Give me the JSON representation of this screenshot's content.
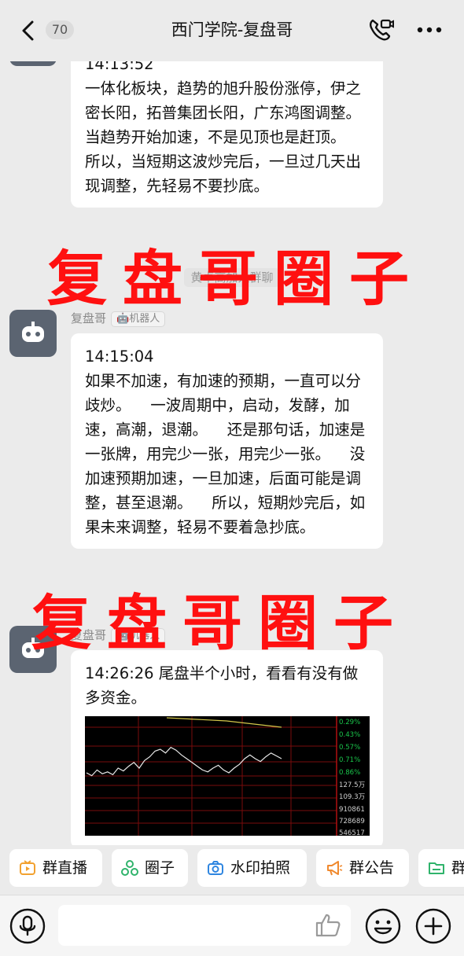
{
  "header": {
    "back_icon": "chevron-left-icon",
    "unread_count": "70",
    "title": "西门学院-复盘哥",
    "call_icon": "video-call-icon",
    "more_icon": "more-dots-icon"
  },
  "messages": [
    {
      "sender": "",
      "time": "14:13:52",
      "text": "一体化板块，趋势的旭升股份涨停，伊之密长阳，拓普集团长阳，广东鸿图调整。    当趋势开始加速，不是见顶也是赶顶。    所以，当短期这波炒完后，一旦过几天出现调整，先轻易不要抄底。"
    },
    {
      "sender": "复盘哥",
      "tag": "机器人",
      "time": "14:15:04",
      "text": "如果不加速，有加速的预期，一直可以分歧炒。    一波周期中，启动，发酵，加速，高潮，退潮。    还是那句话，加速是一张牌，用完少一张，用完少一张。    没加速预期加速，一旦加速，后面可能是调整，甚至退潮。    所以，短期炒完后，如果未来调整，轻易不要着急抄底。"
    },
    {
      "sender": "复盘哥",
      "tag": "机器人",
      "time": "14:26:26",
      "text": "尾盘半个小时，看看有没有做多资金。"
    }
  ],
  "system_notice": "黄卓高加入群聊",
  "watermarks": [
    "复盘哥圈子",
    "复盘哥圈子"
  ],
  "chart_data": {
    "type": "line",
    "title": "",
    "right_axis_labels": [
      "0.29%",
      "0.43%",
      "0.57%",
      "0.71%",
      "0.86%",
      "127.5万",
      "109.3万",
      "910861",
      "728689",
      "546517"
    ],
    "series": [
      {
        "values": [
          0.55,
          0.52,
          0.58,
          0.54,
          0.56,
          0.53,
          0.6,
          0.57,
          0.62,
          0.66,
          0.6,
          0.68,
          0.72,
          0.78,
          0.8,
          0.76,
          0.82,
          0.79,
          0.74,
          0.7,
          0.66,
          0.62,
          0.58,
          0.56,
          0.6,
          0.63,
          0.58,
          0.55,
          0.6,
          0.64,
          0.7,
          0.74,
          0.7,
          0.67,
          0.72,
          0.76,
          0.73,
          0.7
        ]
      }
    ]
  },
  "toolbar": {
    "items": [
      {
        "label": "群直播",
        "icon": "live-tv-icon",
        "color": "#f2a12f"
      },
      {
        "label": "圈子",
        "icon": "circle-group-icon",
        "color": "#2fb36b"
      },
      {
        "label": "水印拍照",
        "icon": "camera-icon",
        "color": "#2f86e0"
      },
      {
        "label": "群公告",
        "icon": "megaphone-icon",
        "color": "#f0892e"
      },
      {
        "label": "群",
        "icon": "folder-icon",
        "color": "#2fb36b"
      }
    ]
  },
  "inputbar": {
    "mic_icon": "microphone-icon",
    "like_icon": "thumbs-up-icon",
    "emoji_icon": "emoji-icon",
    "plus_icon": "plus-icon"
  },
  "colors": {
    "watermark": "#ff1010",
    "background": "#ebebeb",
    "bubble": "#ffffff"
  }
}
